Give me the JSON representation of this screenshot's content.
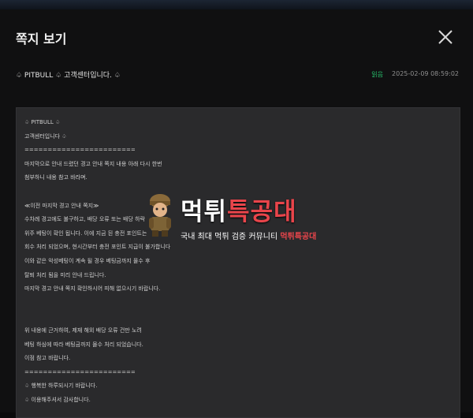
{
  "modal": {
    "title": "쪽지 보기"
  },
  "message": {
    "sender": "♤ PITBULL ♤ 고객센터입니다. ♤",
    "status": "읽음",
    "date": "2025-02-09 08:59:02",
    "lines": [
      "♤ PITBULL ♤",
      "고객센터입니다 ♤",
      "========================",
      "마지막으로 안내 드렸던 경고 안내 쪽지 내용 아래 다시 한번",
      "첨부하니 내용 참고 바라며.",
      "",
      "≪이전 마지막 경고 안내 쪽지≫",
      "수차례 경고에도 불구하고, 배당 오류 또는 배당 하락",
      "위주 베팅이 확인 됩니다. 이에 지금 된 충전 포인트는",
      "회수 처리 되었으며, 현시간부터 충전 포인트 지급이 불가합니다",
      "이와 같은 악성베팅이 계속 될 경우 베팅금까지 몰수 후",
      "탈퇴 처리 됨을 미리 안내 드립니다.",
      "마지막 경고 안내 쪽지 확인하시어 피해 없으시기 바랍니다.",
      "",
      "",
      "위 내용에 근거하여, 제재 해외 배당 오류 건만 노려",
      "베팅 하심에 따라 베팅금까지 몰수 처리 되었습니다.",
      "이점 참고 바랍니다.",
      "========================",
      "♤ 행복한 하루되시기 바랍니다.",
      "♤ 이용해주셔서 감사합니다."
    ]
  },
  "watermark": {
    "brand_main": "먹튀",
    "brand_accent": "특공대",
    "tagline_prefix": "국내 최대 먹튀 검증 커뮤니티",
    "tagline_highlight": "먹튀특공대"
  },
  "icons": {
    "close": "close-icon",
    "mascot": "soldier-mascot-icon"
  }
}
